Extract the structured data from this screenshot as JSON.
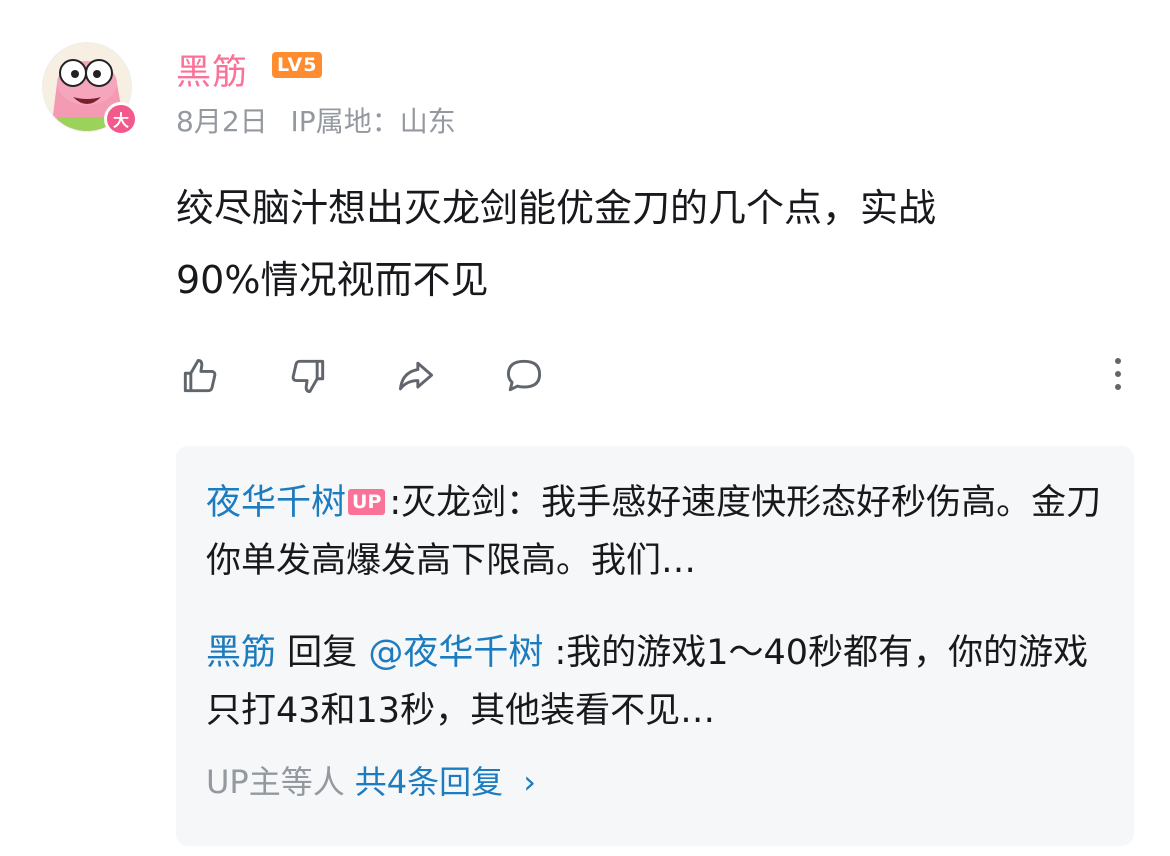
{
  "comment": {
    "username": "黑筋",
    "level": "LV5",
    "vip_badge": "大",
    "date": "8月2日",
    "ip_location": "IP属地：山东",
    "text_line1": "绞尽脑汁想出灭龙剑能优金刀的几个点，实战",
    "text_line2": "90%情况视而不见"
  },
  "actions": {
    "like_icon": "thumbs-up-icon",
    "dislike_icon": "thumbs-down-icon",
    "share_icon": "share-icon",
    "reply_icon": "comment-icon",
    "more_icon": "more-vertical-icon"
  },
  "replies": [
    {
      "author": "夜华千树",
      "tag": "UP",
      "text": ":灭龙剑：我手感好速度快形态好秒伤高。金刀你单发高爆发高下限高。我们…"
    },
    {
      "author": "黑筋",
      "reply_word": "回复",
      "mention": "@夜华千树",
      "text": ":我的游戏1～40秒都有，你的游戏只打43和13秒，其他装看不见…"
    }
  ],
  "more_replies": {
    "prefix": "UP主等人",
    "link": "共4条回复",
    "chevron": "›"
  },
  "colors": {
    "username_pink": "#fb7299",
    "link_blue": "#1d7cbf",
    "level_orange": "#ff8c2f",
    "meta_gray": "#9499a0",
    "reply_bg": "#f6f7f8"
  }
}
